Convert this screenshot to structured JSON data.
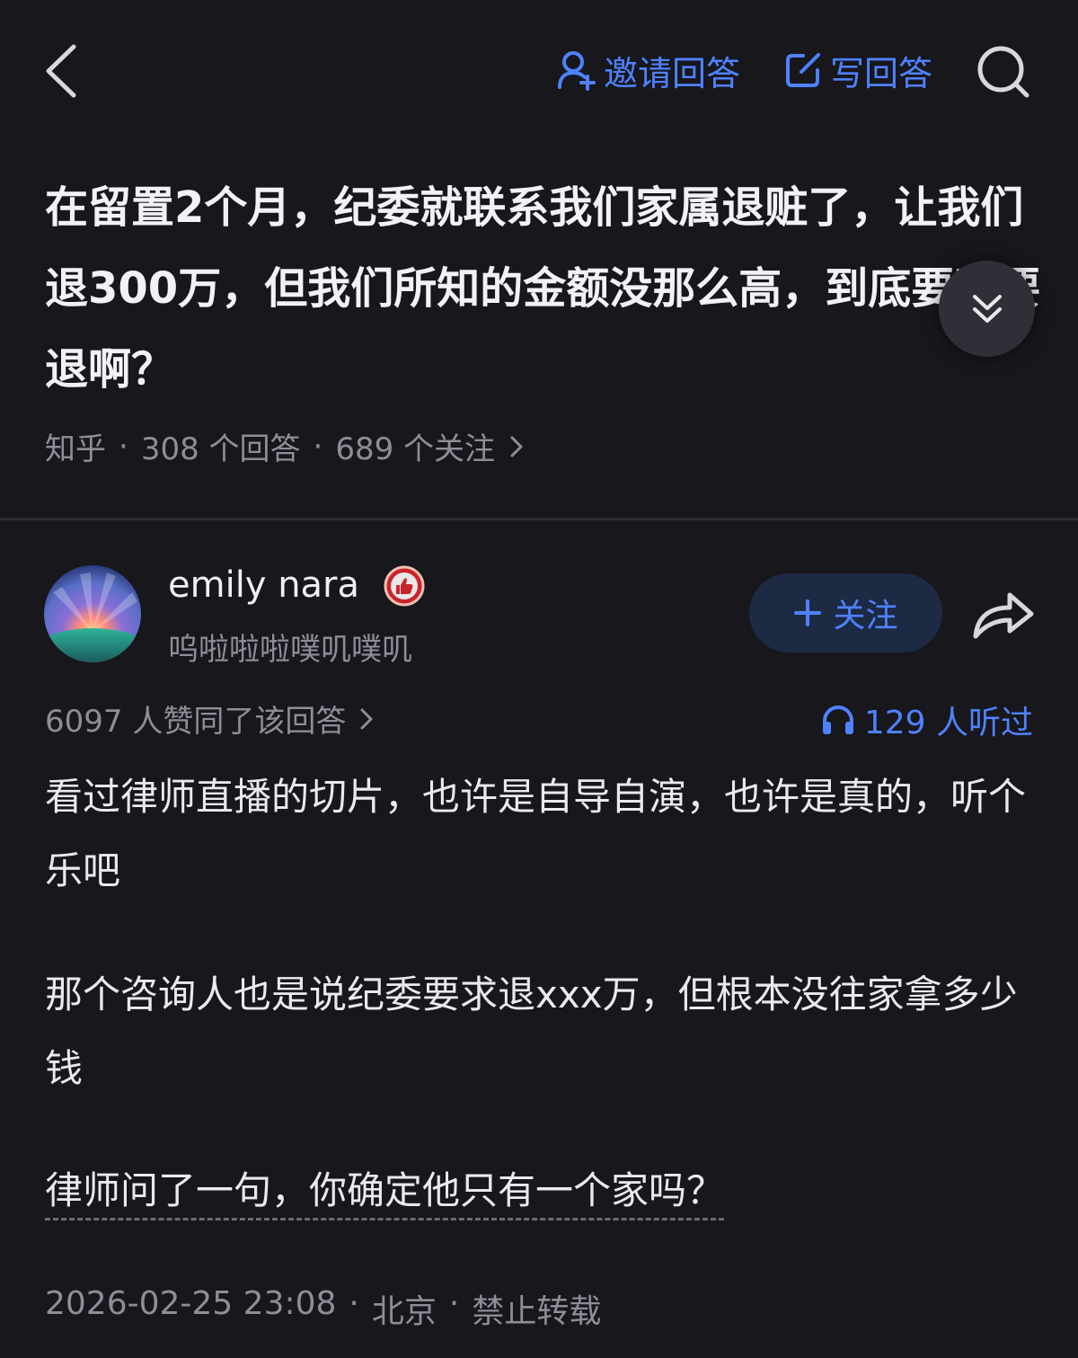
{
  "topbar": {
    "invite_label": "邀请回答",
    "write_label": "写回答",
    "accent": "#4f82ff"
  },
  "question": {
    "title": "在留置2个月，纪委就联系我们家属退赃了，让我们退300万，但我们所知的金额没那么高，到底要不要退啊？",
    "source": "知乎",
    "answers": "308 个回答",
    "followers": "689 个关注"
  },
  "answer": {
    "author_name": "emily nara",
    "author_bio": "呜啦啦啦噗叽噗叽",
    "follow_label": "关注",
    "votes": "6097 人赞同了该回答",
    "listens": "129 人听过",
    "paragraphs": [
      "看过律师直播的切片，也许是自导自演，也许是真的，听个乐吧",
      "那个咨询人也是说纪委要求退xxx万，但根本没往家拿多少钱",
      "律师问了一句，你确定他只有一个家吗？"
    ],
    "date": "2026-02-25 23:08",
    "location": "北京",
    "rights": "禁止转载"
  }
}
